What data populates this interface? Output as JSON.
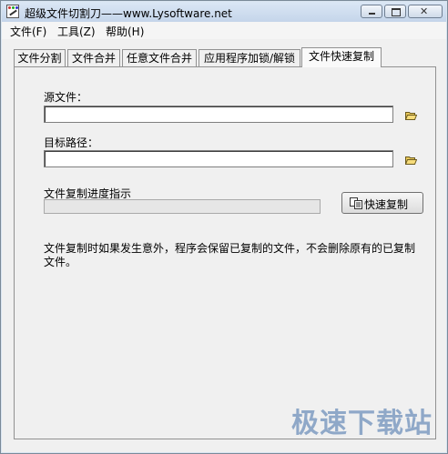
{
  "window": {
    "title": "超级文件切割刀——www.Lysoftware.net"
  },
  "menu": [
    {
      "label": "文件(F)"
    },
    {
      "label": "工具(Z)"
    },
    {
      "label": "帮助(H)"
    }
  ],
  "tabs": [
    {
      "label": "文件分割"
    },
    {
      "label": "文件合并"
    },
    {
      "label": "任意文件合并"
    },
    {
      "label": "应用程序加锁/解锁"
    },
    {
      "label": "文件快速复制"
    }
  ],
  "active_tab": 4,
  "form": {
    "source_label": "源文件：",
    "source_value": "",
    "target_label": "目标路径：",
    "target_value": "",
    "progress_label": "文件复制进度指示",
    "progress": 0,
    "copy_button": "快速复制",
    "note": "文件复制时如果发生意外，程序会保留已复制的文件，不会删除原有的已复制文件。"
  },
  "watermark": "极速下载站"
}
